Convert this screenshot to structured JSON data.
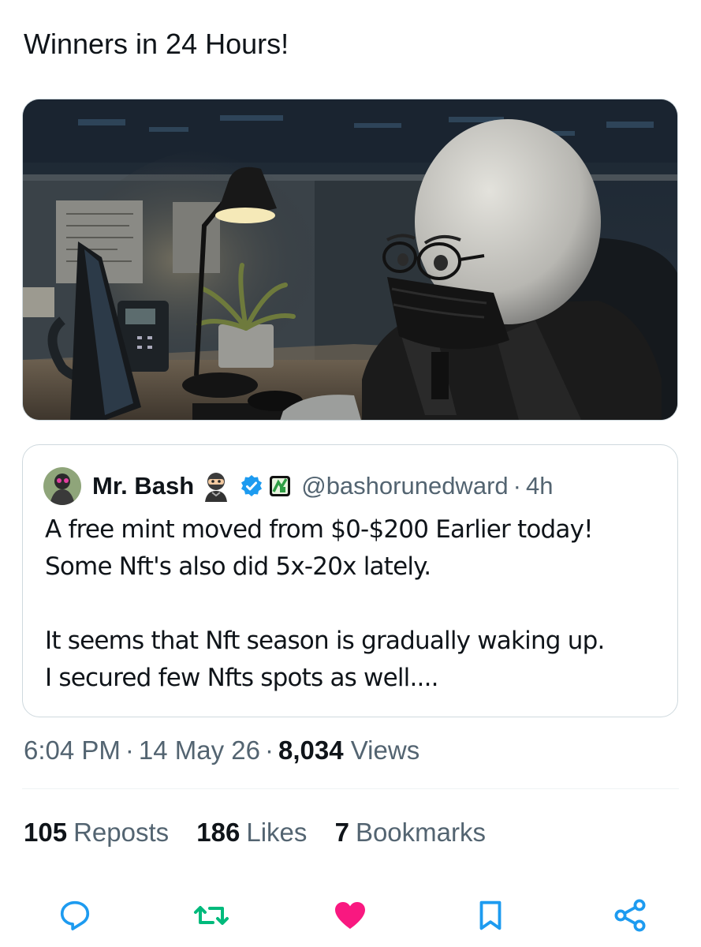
{
  "tweet": {
    "text": "Winners in 24 Hours!"
  },
  "quote": {
    "name": "Mr. Bash",
    "name_emoji": "ninja-emoji",
    "verified_icon": "verified-badge-icon",
    "affiliate_icon": "affiliate-badge-icon",
    "handle": "@bashorunedward",
    "separator": "·",
    "time": "4h",
    "body_lines_1": [
      "A free mint moved from $0-$200 Earlier today!",
      "Some Nft's also did 5x-20x lately."
    ],
    "body_lines_2": [
      "It seems that Nft season is gradually waking up.",
      "I secured few Nfts spots as well...."
    ]
  },
  "meta": {
    "time": "6:04 PM",
    "separator": "·",
    "date": "14 May 26",
    "views_count": "8,034",
    "views_label": "Views"
  },
  "stats": {
    "reposts_count": "105",
    "reposts_label": "Reposts",
    "likes_count": "186",
    "likes_label": "Likes",
    "bookmarks_count": "7",
    "bookmarks_label": "Bookmarks"
  },
  "actions": [
    {
      "icon": "reply-icon",
      "color": "#1d9bf0"
    },
    {
      "icon": "repost-icon",
      "color": "#00ba7c"
    },
    {
      "icon": "like-icon",
      "color": "#f91880"
    },
    {
      "icon": "bookmark-icon",
      "color": "#1d9bf0"
    },
    {
      "icon": "share-icon",
      "color": "#1d9bf0"
    }
  ],
  "colors": {
    "text": "#0f1419",
    "secondary": "#536471",
    "border": "#cfd9de",
    "accent": "#1d9bf0",
    "repost": "#00ba7c",
    "like": "#f91880"
  }
}
